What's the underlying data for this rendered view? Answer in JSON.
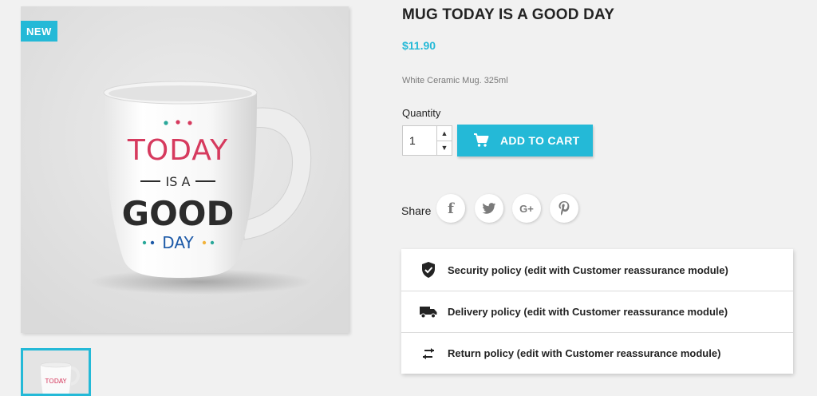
{
  "product": {
    "badge": "NEW",
    "title": "MUG TODAY IS A GOOD DAY",
    "price": "$11.90",
    "description": "White Ceramic Mug. 325ml",
    "image_text": {
      "line1": "TODAY",
      "line2": "IS A",
      "line3": "GOOD",
      "line4": "DAY"
    }
  },
  "quantity": {
    "label": "Quantity",
    "value": "1",
    "increment_glyph": "▲",
    "decrement_glyph": "▼"
  },
  "cart": {
    "button_label": "ADD TO CART",
    "icon": "cart-icon"
  },
  "share": {
    "label": "Share",
    "networks": [
      {
        "name": "facebook",
        "glyph": "f"
      },
      {
        "name": "twitter",
        "glyph": "twitter-icon"
      },
      {
        "name": "google-plus",
        "glyph": "G+"
      },
      {
        "name": "pinterest",
        "glyph": "P"
      }
    ]
  },
  "reassurance": [
    {
      "icon": "shield-check-icon",
      "text": "Security policy (edit with Customer reassurance module)"
    },
    {
      "icon": "truck-icon",
      "text": "Delivery policy (edit with Customer reassurance module)"
    },
    {
      "icon": "swap-arrows-icon",
      "text": "Return policy (edit with Customer reassurance module)"
    }
  ],
  "colors": {
    "accent": "#24b9d7",
    "background": "#f1f1f1",
    "text": "#232323",
    "mug_red": "#d63a5e",
    "mug_dark": "#2c2c2c"
  }
}
